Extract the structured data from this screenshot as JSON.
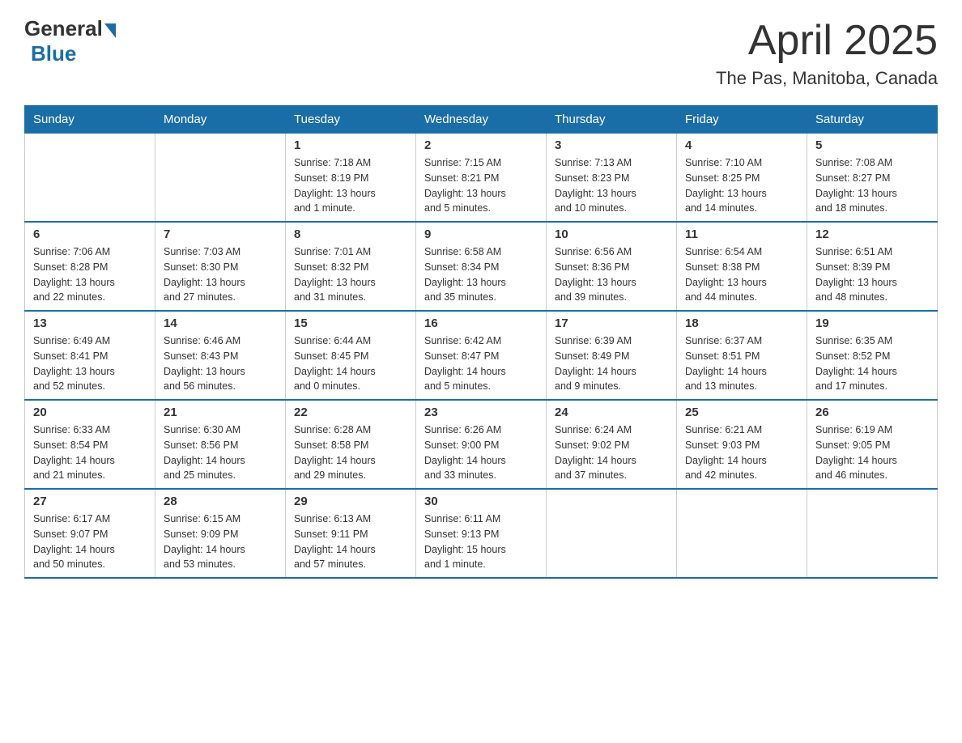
{
  "header": {
    "logo_general": "General",
    "logo_blue": "Blue",
    "month_title": "April 2025",
    "location": "The Pas, Manitoba, Canada"
  },
  "weekdays": [
    "Sunday",
    "Monday",
    "Tuesday",
    "Wednesday",
    "Thursday",
    "Friday",
    "Saturday"
  ],
  "weeks": [
    [
      {
        "day": "",
        "info": ""
      },
      {
        "day": "",
        "info": ""
      },
      {
        "day": "1",
        "info": "Sunrise: 7:18 AM\nSunset: 8:19 PM\nDaylight: 13 hours\nand 1 minute."
      },
      {
        "day": "2",
        "info": "Sunrise: 7:15 AM\nSunset: 8:21 PM\nDaylight: 13 hours\nand 5 minutes."
      },
      {
        "day": "3",
        "info": "Sunrise: 7:13 AM\nSunset: 8:23 PM\nDaylight: 13 hours\nand 10 minutes."
      },
      {
        "day": "4",
        "info": "Sunrise: 7:10 AM\nSunset: 8:25 PM\nDaylight: 13 hours\nand 14 minutes."
      },
      {
        "day": "5",
        "info": "Sunrise: 7:08 AM\nSunset: 8:27 PM\nDaylight: 13 hours\nand 18 minutes."
      }
    ],
    [
      {
        "day": "6",
        "info": "Sunrise: 7:06 AM\nSunset: 8:28 PM\nDaylight: 13 hours\nand 22 minutes."
      },
      {
        "day": "7",
        "info": "Sunrise: 7:03 AM\nSunset: 8:30 PM\nDaylight: 13 hours\nand 27 minutes."
      },
      {
        "day": "8",
        "info": "Sunrise: 7:01 AM\nSunset: 8:32 PM\nDaylight: 13 hours\nand 31 minutes."
      },
      {
        "day": "9",
        "info": "Sunrise: 6:58 AM\nSunset: 8:34 PM\nDaylight: 13 hours\nand 35 minutes."
      },
      {
        "day": "10",
        "info": "Sunrise: 6:56 AM\nSunset: 8:36 PM\nDaylight: 13 hours\nand 39 minutes."
      },
      {
        "day": "11",
        "info": "Sunrise: 6:54 AM\nSunset: 8:38 PM\nDaylight: 13 hours\nand 44 minutes."
      },
      {
        "day": "12",
        "info": "Sunrise: 6:51 AM\nSunset: 8:39 PM\nDaylight: 13 hours\nand 48 minutes."
      }
    ],
    [
      {
        "day": "13",
        "info": "Sunrise: 6:49 AM\nSunset: 8:41 PM\nDaylight: 13 hours\nand 52 minutes."
      },
      {
        "day": "14",
        "info": "Sunrise: 6:46 AM\nSunset: 8:43 PM\nDaylight: 13 hours\nand 56 minutes."
      },
      {
        "day": "15",
        "info": "Sunrise: 6:44 AM\nSunset: 8:45 PM\nDaylight: 14 hours\nand 0 minutes."
      },
      {
        "day": "16",
        "info": "Sunrise: 6:42 AM\nSunset: 8:47 PM\nDaylight: 14 hours\nand 5 minutes."
      },
      {
        "day": "17",
        "info": "Sunrise: 6:39 AM\nSunset: 8:49 PM\nDaylight: 14 hours\nand 9 minutes."
      },
      {
        "day": "18",
        "info": "Sunrise: 6:37 AM\nSunset: 8:51 PM\nDaylight: 14 hours\nand 13 minutes."
      },
      {
        "day": "19",
        "info": "Sunrise: 6:35 AM\nSunset: 8:52 PM\nDaylight: 14 hours\nand 17 minutes."
      }
    ],
    [
      {
        "day": "20",
        "info": "Sunrise: 6:33 AM\nSunset: 8:54 PM\nDaylight: 14 hours\nand 21 minutes."
      },
      {
        "day": "21",
        "info": "Sunrise: 6:30 AM\nSunset: 8:56 PM\nDaylight: 14 hours\nand 25 minutes."
      },
      {
        "day": "22",
        "info": "Sunrise: 6:28 AM\nSunset: 8:58 PM\nDaylight: 14 hours\nand 29 minutes."
      },
      {
        "day": "23",
        "info": "Sunrise: 6:26 AM\nSunset: 9:00 PM\nDaylight: 14 hours\nand 33 minutes."
      },
      {
        "day": "24",
        "info": "Sunrise: 6:24 AM\nSunset: 9:02 PM\nDaylight: 14 hours\nand 37 minutes."
      },
      {
        "day": "25",
        "info": "Sunrise: 6:21 AM\nSunset: 9:03 PM\nDaylight: 14 hours\nand 42 minutes."
      },
      {
        "day": "26",
        "info": "Sunrise: 6:19 AM\nSunset: 9:05 PM\nDaylight: 14 hours\nand 46 minutes."
      }
    ],
    [
      {
        "day": "27",
        "info": "Sunrise: 6:17 AM\nSunset: 9:07 PM\nDaylight: 14 hours\nand 50 minutes."
      },
      {
        "day": "28",
        "info": "Sunrise: 6:15 AM\nSunset: 9:09 PM\nDaylight: 14 hours\nand 53 minutes."
      },
      {
        "day": "29",
        "info": "Sunrise: 6:13 AM\nSunset: 9:11 PM\nDaylight: 14 hours\nand 57 minutes."
      },
      {
        "day": "30",
        "info": "Sunrise: 6:11 AM\nSunset: 9:13 PM\nDaylight: 15 hours\nand 1 minute."
      },
      {
        "day": "",
        "info": ""
      },
      {
        "day": "",
        "info": ""
      },
      {
        "day": "",
        "info": ""
      }
    ]
  ]
}
